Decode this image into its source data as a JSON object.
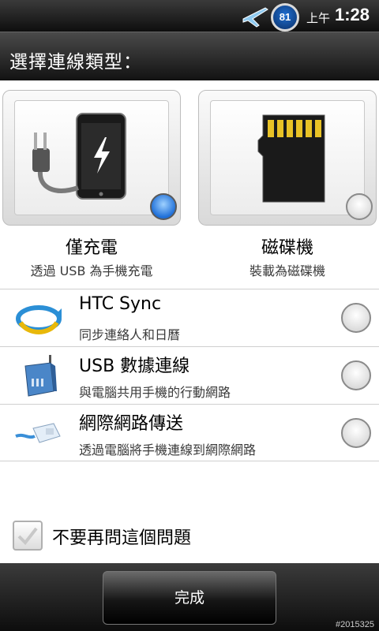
{
  "status_bar": {
    "battery_level": "81",
    "am_pm": "上午",
    "time": "1:28"
  },
  "dialog": {
    "title": "選擇連線類型："
  },
  "options": {
    "charge": {
      "label": "僅充電",
      "description": "透過 USB 為手機充電",
      "selected": true
    },
    "disk": {
      "label": "磁碟機",
      "description": "裝載為磁碟機",
      "selected": false
    }
  },
  "list_items": [
    {
      "title": "HTC Sync",
      "subtitle": "同步連絡人和日曆",
      "icon": "sync-icon"
    },
    {
      "title": "USB 數據連線",
      "subtitle": "與電腦共用手機的行動網路",
      "icon": "modem-icon"
    },
    {
      "title": "網際網路傳送",
      "subtitle": "透過電腦將手機連線到網際網路",
      "icon": "ethernet-cable-icon"
    }
  ],
  "dont_ask": {
    "label": "不要再問這個問題",
    "checked": true
  },
  "done_label": "完成",
  "watermark": "#2015325",
  "colors": {
    "accent_blue": "#1e6fd8",
    "bar_dark": "#121212"
  }
}
